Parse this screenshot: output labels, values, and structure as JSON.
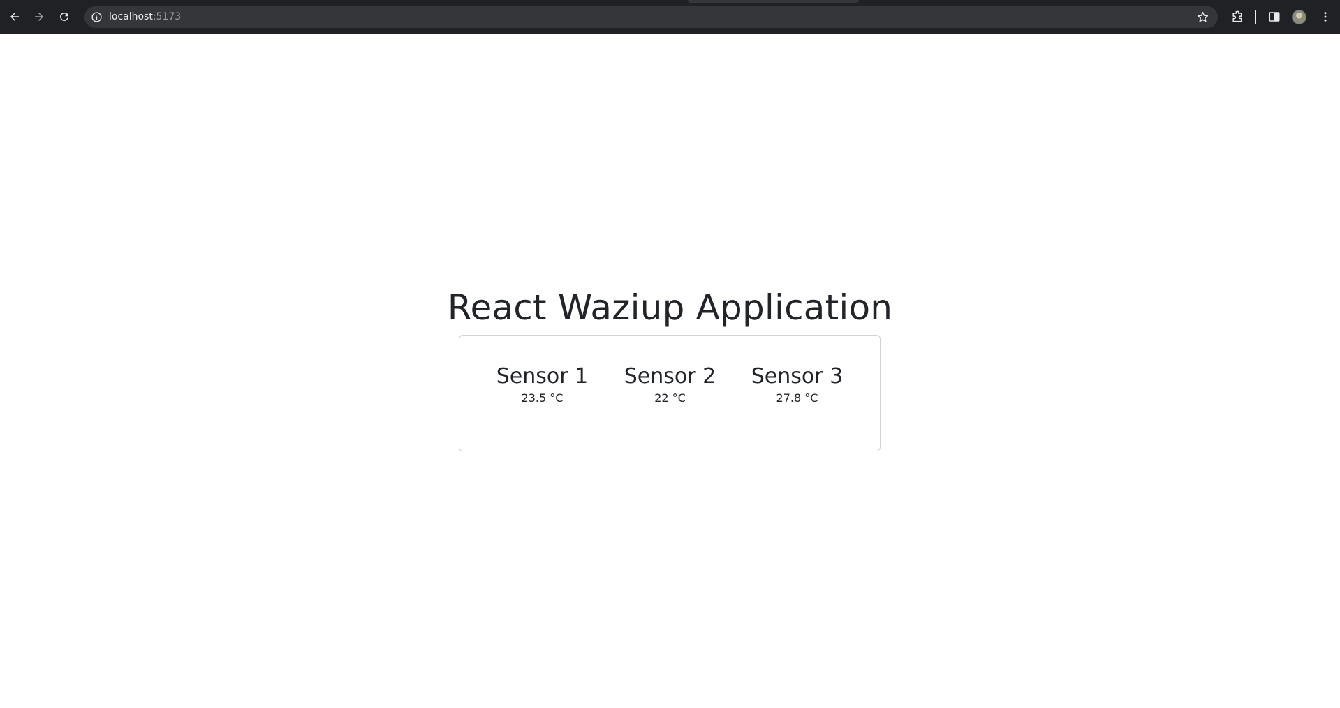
{
  "browser": {
    "url_host": "localhost",
    "url_port": ":5173",
    "icons": {
      "back": "arrow-left-icon",
      "forward": "arrow-right-icon",
      "reload": "reload-icon",
      "site_info": "info-icon",
      "bookmark": "star-icon",
      "extensions": "puzzle-icon",
      "side_panel": "side-panel-icon",
      "profile": "avatar",
      "menu": "kebab-menu-icon"
    },
    "colors": {
      "toolbar_bg": "#202124",
      "omnibox_bg": "#35363a",
      "text": "#e8eaed",
      "muted": "#9aa0a6"
    }
  },
  "app": {
    "title": "React Waziup Application",
    "sensors": [
      {
        "name": "Sensor 1",
        "value": "23.5 °C"
      },
      {
        "name": "Sensor 2",
        "value": "22 °C"
      },
      {
        "name": "Sensor 3",
        "value": "27.8 °C"
      }
    ],
    "colors": {
      "text": "#212529",
      "card_border": "#dee2e6",
      "background": "#ffffff"
    }
  }
}
